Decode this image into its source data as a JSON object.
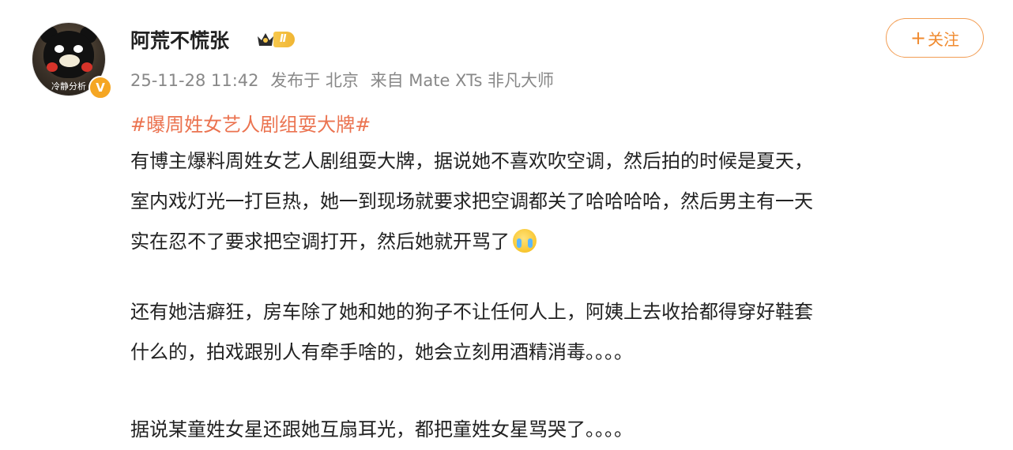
{
  "author": {
    "name": "阿荒不慌张",
    "avatar_caption": "冷静分析",
    "verified_mark": "V",
    "level_label": "Ⅱ"
  },
  "follow_button": {
    "plus": "+",
    "label": "关注"
  },
  "meta": {
    "timestamp": "25-11-28 11:42",
    "location": "发布于 北京",
    "source": "来自 Mate XTs 非凡大师"
  },
  "post": {
    "topic": "#曝周姓女艺人剧组耍大牌#",
    "paragraph1": {
      "line1": "有博主爆料周姓女艺人剧组耍大牌，据说她不喜欢吹空调，然后拍的时候是夏天，",
      "line2": "室内戏灯光一打巨热，她一到现场就要求把空调都关了哈哈哈哈，然后男主有一天",
      "line3": "实在忍不了要求把空调打开，然后她就开骂了",
      "emoji": "crying-face-emoji"
    },
    "paragraph2": {
      "line1": "还有她洁癖狂，房车除了她和她的狗子不让任何人上，阿姨上去收拾都得穿好鞋套",
      "line2": "什么的，拍戏跟别人有牵手啥的，她会立刻用酒精消毒。。。。"
    },
    "paragraph3": {
      "line1": "据说某童姓女星还跟她互扇耳光，都把童姓女星骂哭了。。。。"
    }
  },
  "colors": {
    "accent_orange": "#f08a2e",
    "topic_color": "#eb7350",
    "meta_gray": "#888888",
    "badge_gold": "#f5a623"
  }
}
